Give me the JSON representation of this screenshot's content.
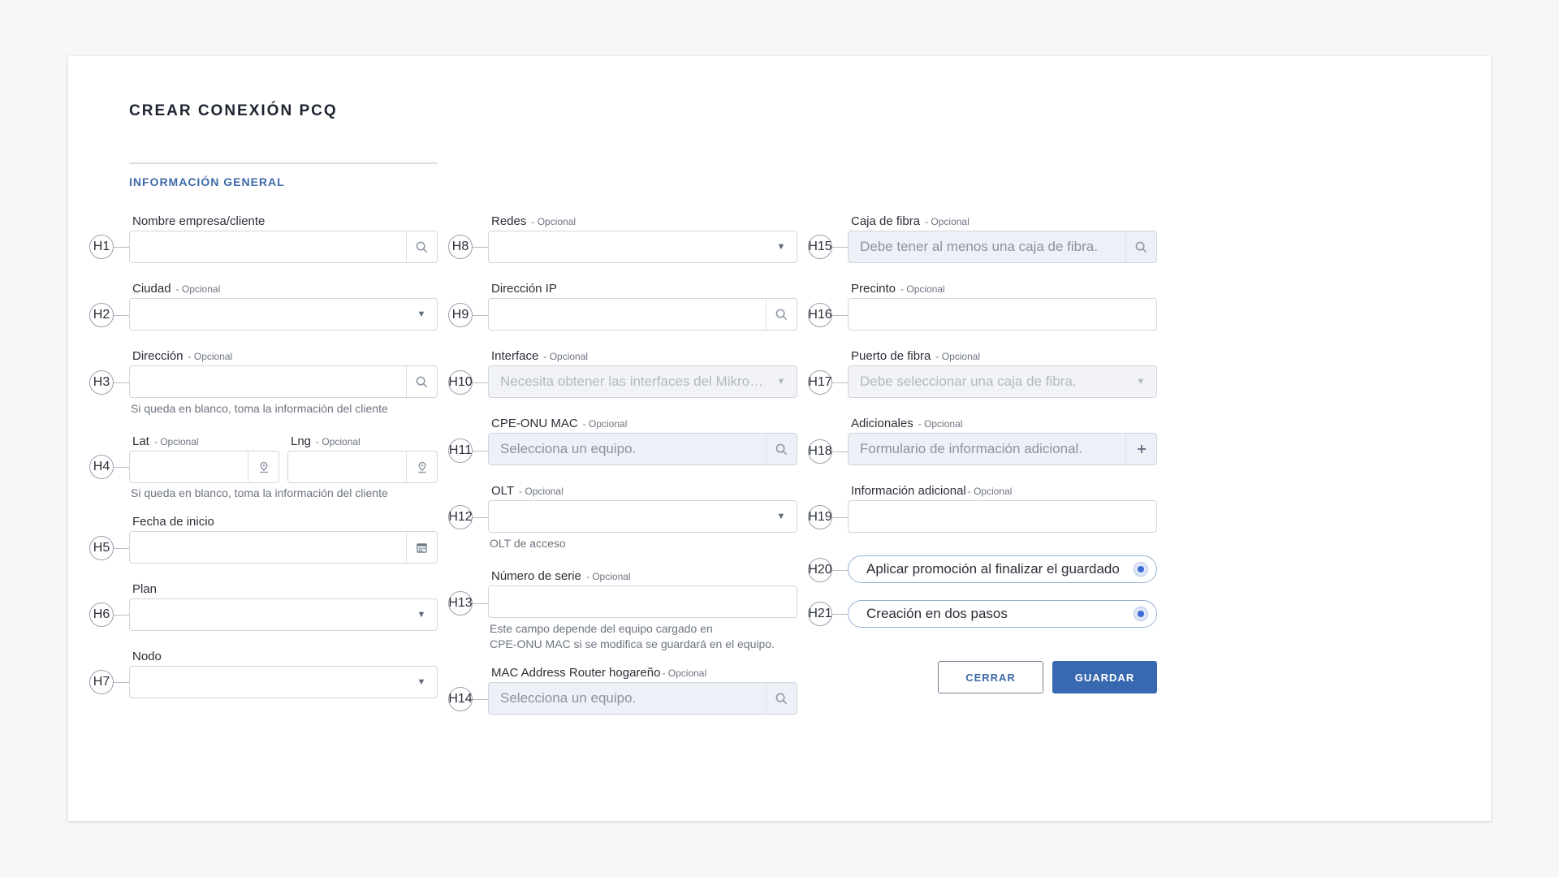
{
  "page": {
    "title": "CREAR CONEXIÓN PCQ",
    "section_title": "INFORMACIÓN GENERAL"
  },
  "markers": [
    "H1",
    "H2",
    "H3",
    "H4",
    "H5",
    "H6",
    "H7",
    "H8",
    "H9",
    "H10",
    "H11",
    "H12",
    "H13",
    "H14",
    "H15",
    "H16",
    "H17",
    "H18",
    "H19",
    "H20",
    "H21"
  ],
  "fields": {
    "nombre": {
      "label": "Nombre empresa/cliente",
      "icon": "search-icon"
    },
    "ciudad": {
      "label": "Ciudad",
      "optional": "- Opcional",
      "icon": "chevron-down-icon"
    },
    "direccion": {
      "label": "Dirección",
      "optional": "- Opcional",
      "icon": "search-icon",
      "help": "Si queda en blanco, toma la información del cliente"
    },
    "lat": {
      "label": "Lat",
      "optional": "- Opcional",
      "icon": "map-pin-icon"
    },
    "lng": {
      "label": "Lng",
      "optional": "- Opcional",
      "icon": "map-pin-icon",
      "help": "Si queda en blanco, toma la información del cliente"
    },
    "fecha": {
      "label": "Fecha de inicio",
      "icon": "calendar-icon"
    },
    "plan": {
      "label": "Plan",
      "icon": "chevron-down-icon"
    },
    "nodo": {
      "label": "Nodo",
      "icon": "chevron-down-icon"
    },
    "redes": {
      "label": "Redes",
      "optional": "- Opcional",
      "icon": "chevron-down-icon"
    },
    "ip": {
      "label": "Dirección IP",
      "icon": "search-icon"
    },
    "interface": {
      "label": "Interface",
      "optional": "- Opcional",
      "placeholder": "Necesita obtener las interfaces del Mikrotik.",
      "icon": "chevron-down-icon"
    },
    "cpe": {
      "label": "CPE-ONU MAC",
      "optional": "- Opcional",
      "placeholder": "Selecciona un equipo.",
      "icon": "search-icon"
    },
    "olt": {
      "label": "OLT",
      "optional": "- Opcional",
      "icon": "chevron-down-icon",
      "help": "OLT de acceso"
    },
    "serie": {
      "label": "Número de serie",
      "optional": "- Opcional",
      "help1": "Este campo depende del equipo cargado en",
      "help2": "CPE-ONU MAC si se modifica se guardará en el equipo."
    },
    "mac_router": {
      "label": "MAC Address Router hogareño",
      "optional": "- Opcional",
      "placeholder": "Selecciona un equipo.",
      "icon": "search-icon"
    },
    "caja": {
      "label": "Caja de fibra",
      "optional": "- Opcional",
      "placeholder": "Debe tener al menos una caja de fibra.",
      "icon": "search-icon"
    },
    "precinto": {
      "label": "Precinto",
      "optional": "- Opcional"
    },
    "puerto": {
      "label": "Puerto de fibra",
      "optional": "- Opcional",
      "placeholder": "Debe seleccionar una caja de fibra.",
      "icon": "chevron-down-icon"
    },
    "adicionales": {
      "label": "Adicionales",
      "optional": "- Opcional",
      "placeholder": "Formulario de información adicional.",
      "icon": "plus-icon"
    },
    "info_adicional": {
      "label": "Información adicional",
      "optional": "- Opcional"
    }
  },
  "toggles": {
    "promocion": {
      "label": "Aplicar promoción al finalizar el guardado"
    },
    "dos_pasos": {
      "label": "Creación en dos pasos"
    }
  },
  "buttons": {
    "cerrar": "CERRAR",
    "guardar": "GUARDAR"
  },
  "colors": {
    "accent": "#3768b0",
    "section": "#3f6aa8",
    "toggle_dot": "#3d6cd6"
  }
}
